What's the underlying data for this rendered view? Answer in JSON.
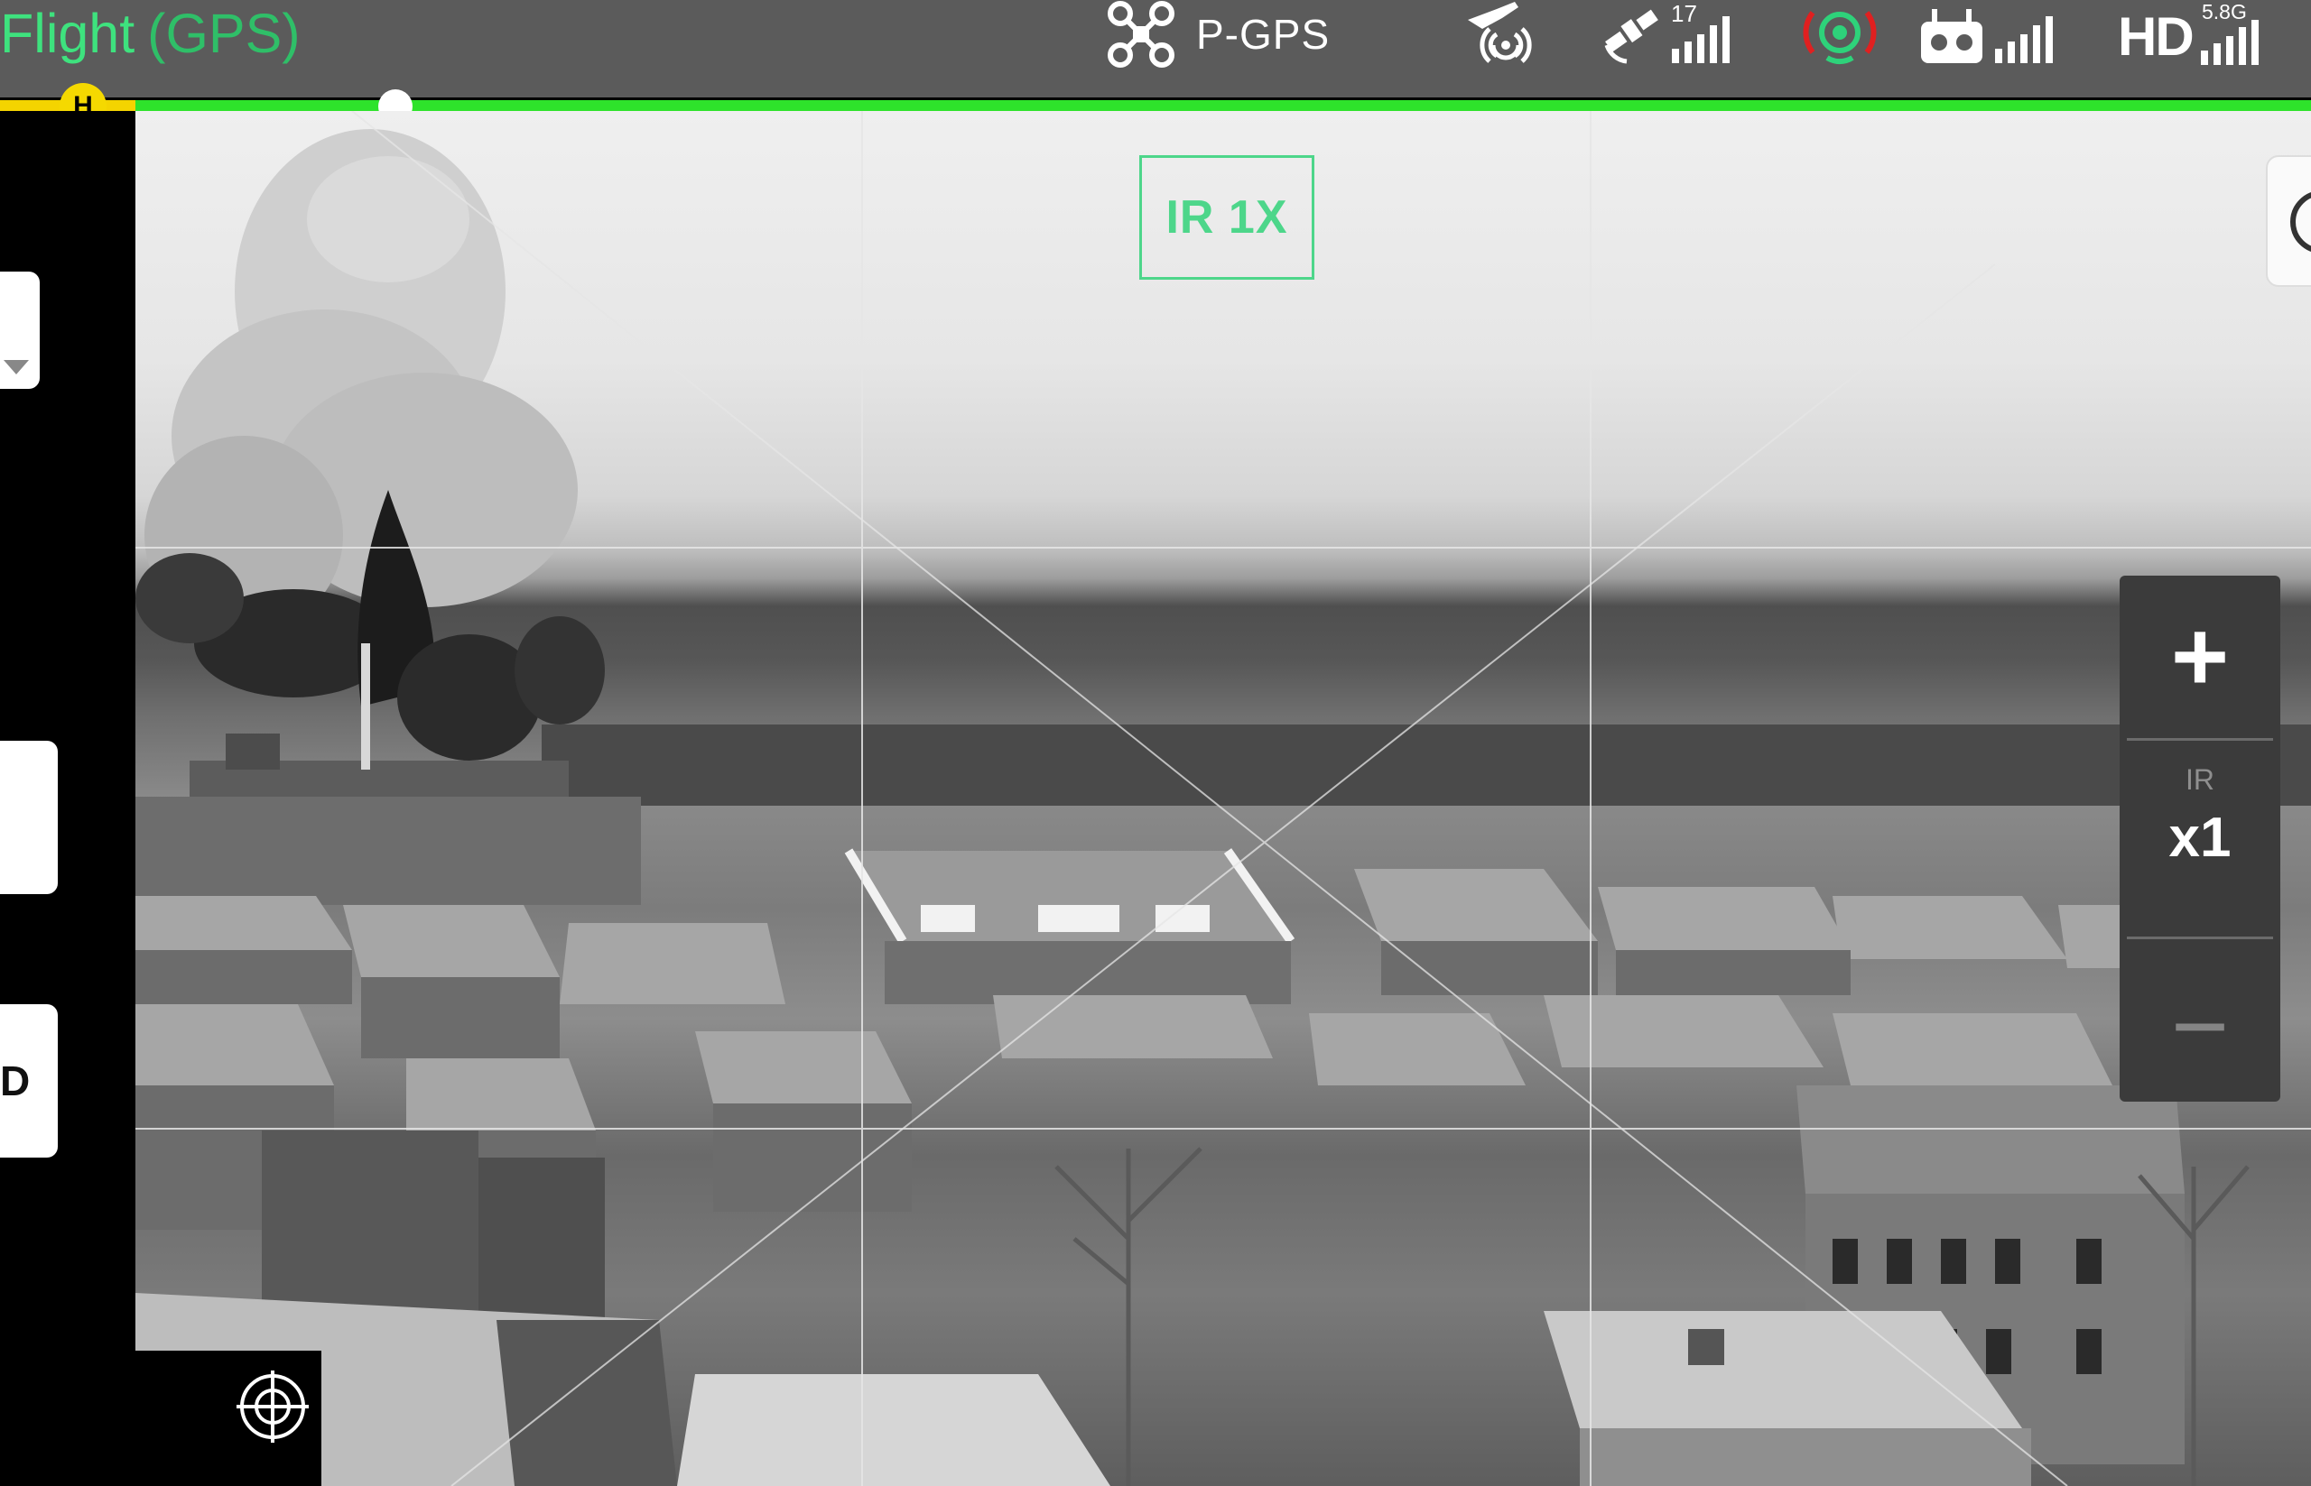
{
  "header": {
    "flight_mode_word": "Flight",
    "flight_mode_paren": "(GPS)",
    "drone_mode": "P-GPS",
    "satellite_count": "17",
    "video_band": "5.8G",
    "video_label": "HD"
  },
  "home_marker": {
    "label": "H"
  },
  "colors": {
    "accent_green": "#3ee27e",
    "bar_green": "#2ee32b",
    "home_yellow": "#f5d900",
    "rtk_red": "#e02020"
  },
  "camera": {
    "overlay_label": "IR 1X"
  },
  "zoom": {
    "plus_label": "+",
    "mode_label": "IR",
    "value_label": "x1",
    "minus_label": "−"
  },
  "left_panel": {
    "tab3_label": "D"
  },
  "icons": {
    "drone": "drone-icon",
    "remote_id": "aircraft-broadcast-icon",
    "satellite": "satellite-icon",
    "rtk": "rtk-signal-icon",
    "controller": "remote-controller-icon",
    "signal": "signal-bars-icon",
    "target": "crosshair-target-icon",
    "camera_settings": "camera-settings-icon"
  }
}
